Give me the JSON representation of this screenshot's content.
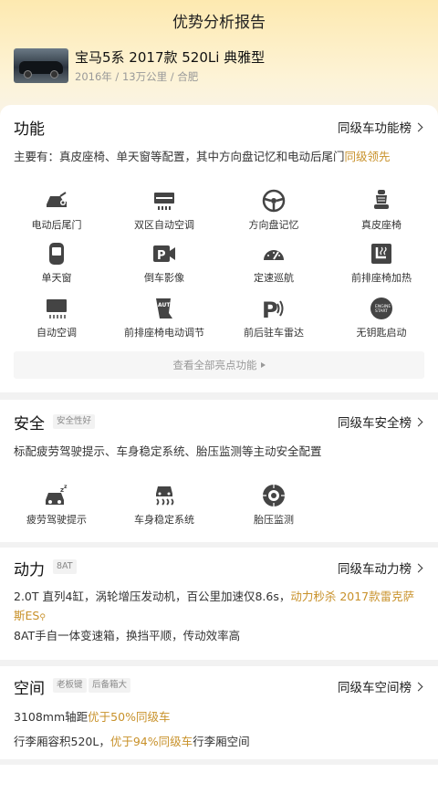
{
  "page": {
    "title": "优势分析报告"
  },
  "car": {
    "name": "宝马5系 2017款 520Li 典雅型",
    "sub": "2016年 / 13万公里 / 合肥"
  },
  "features": {
    "title": "功能",
    "link": "同级车功能榜",
    "desc_a": "主要有：真皮座椅、单天窗等配置，其中方向盘记忆和电动后尾门",
    "desc_b": "同级领先",
    "items": [
      {
        "label": "电动后尾门",
        "icon": "tailgate-icon"
      },
      {
        "label": "双区自动空调",
        "icon": "dual-zone-ac-icon"
      },
      {
        "label": "方向盘记忆",
        "icon": "steering-wheel-icon"
      },
      {
        "label": "真皮座椅",
        "icon": "leather-seat-icon"
      },
      {
        "label": "单天窗",
        "icon": "sunroof-icon"
      },
      {
        "label": "倒车影像",
        "icon": "reverse-camera-icon"
      },
      {
        "label": "定速巡航",
        "icon": "cruise-control-icon"
      },
      {
        "label": "前排座椅加热",
        "icon": "seat-heating-icon"
      },
      {
        "label": "自动空调",
        "icon": "auto-ac-icon"
      },
      {
        "label": "前排座椅电动调节",
        "icon": "power-seat-icon"
      },
      {
        "label": "前后驻车雷达",
        "icon": "parking-radar-icon"
      },
      {
        "label": "无钥匙启动",
        "icon": "keyless-start-icon"
      }
    ],
    "view_all": "查看全部亮点功能"
  },
  "safety": {
    "title": "安全",
    "tag": "安全性好",
    "link": "同级车安全榜",
    "desc": "标配疲劳驾驶提示、车身稳定系统、胎压监测等主动安全配置",
    "items": [
      {
        "label": "疲劳驾驶提示",
        "icon": "fatigue-warning-icon"
      },
      {
        "label": "车身稳定系统",
        "icon": "stability-control-icon"
      },
      {
        "label": "胎压监测",
        "icon": "tire-pressure-icon"
      }
    ]
  },
  "power": {
    "title": "动力",
    "tag": "8AT",
    "link": "同级车动力榜",
    "line1_a": "2.0T 直列4缸，涡轮增压发动机，百公里加速仅8.6s，",
    "line1_b": "动力秒杀 2017款雷",
    "line1_c": "克萨斯ES",
    "line2": "8AT手自一体变速箱，换挡平顺，传动效率高"
  },
  "space": {
    "title": "空间",
    "tags": [
      "老板键",
      "后备箱大"
    ],
    "link": "同级车空间榜",
    "line1_a": "3108mm轴距",
    "line1_b": "优于50%同级车",
    "line2_a": "行李厢容积520L，",
    "line2_b": "优于94%同级车",
    "line2_c": "行李厢空间"
  },
  "colors": {
    "accent": "#c8912a",
    "header_bg": "#fde9b0"
  }
}
